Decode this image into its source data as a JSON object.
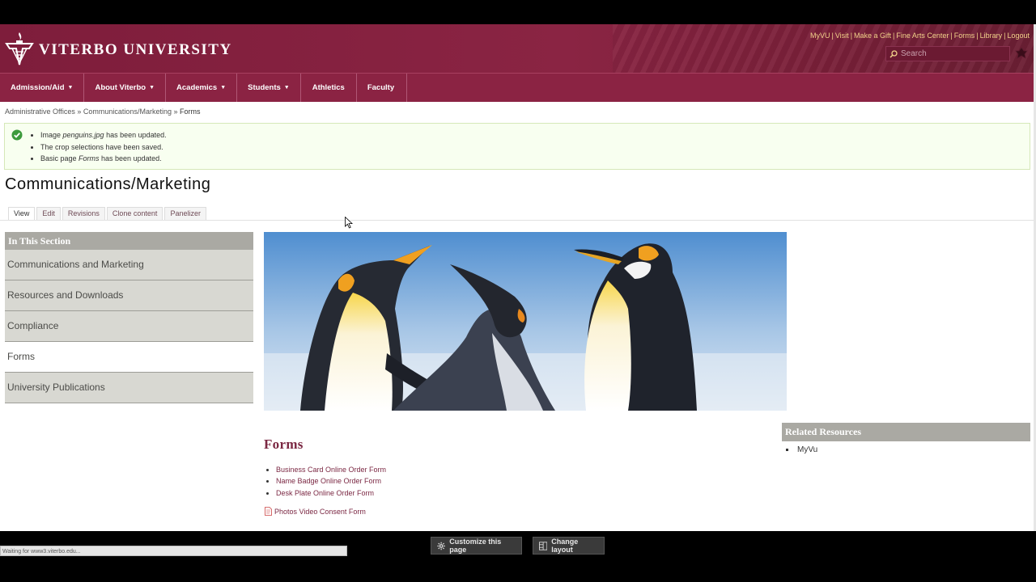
{
  "header": {
    "logo_text": "VITERBO UNIVERSITY",
    "utility_links": [
      "MyVU",
      "Visit",
      "Make a Gift",
      "Fine Arts Center",
      "Forms",
      "Library",
      "Logout"
    ],
    "search_placeholder": "Search"
  },
  "nav": {
    "items": [
      {
        "label": "Admission/Aid",
        "dropdown": true
      },
      {
        "label": "About Viterbo",
        "dropdown": true
      },
      {
        "label": "Academics",
        "dropdown": true
      },
      {
        "label": "Students",
        "dropdown": true
      },
      {
        "label": "Athletics",
        "dropdown": false
      },
      {
        "label": "Faculty",
        "dropdown": false
      }
    ]
  },
  "breadcrumb": {
    "items": [
      "Administrative Offices",
      "Communications/Marketing"
    ],
    "current": "Forms",
    "separator": "»"
  },
  "messages": {
    "m1_a": "Image ",
    "m1_em": "penguins.jpg",
    "m1_b": " has been updated.",
    "m2": "The crop selections have been saved.",
    "m3_a": "Basic page ",
    "m3_em": "Forms",
    "m3_b": " has been updated."
  },
  "page_title": "Communications/Marketing",
  "tabs": [
    "View",
    "Edit",
    "Revisions",
    "Clone content",
    "Panelizer"
  ],
  "sidebar": {
    "heading": "In This Section",
    "items": [
      {
        "label": "Communications and Marketing",
        "current": false
      },
      {
        "label": "Resources and Downloads",
        "current": false
      },
      {
        "label": "Compliance",
        "current": false
      },
      {
        "label": "Forms",
        "current": true
      },
      {
        "label": "University Publications",
        "current": false
      }
    ]
  },
  "forms": {
    "title": "Forms",
    "links": [
      "Business Card Online Order Form",
      "Name Badge Online Order Form",
      "Desk Plate Online Order Form"
    ],
    "pdf_link": "Photos Video Consent Form"
  },
  "related": {
    "heading": "Related Resources",
    "items": [
      "MyVu"
    ]
  },
  "bottom": {
    "status": "Waiting for www3.viterbo.edu...",
    "customize_label": "Customize this page",
    "layout_label": "Change layout"
  },
  "colors": {
    "brand": "#8b2343",
    "utility_link": "#f2d28a",
    "sidebar_bg": "#d8d8d2",
    "heading_bg": "#aaa9a3",
    "link": "#7b2843"
  }
}
